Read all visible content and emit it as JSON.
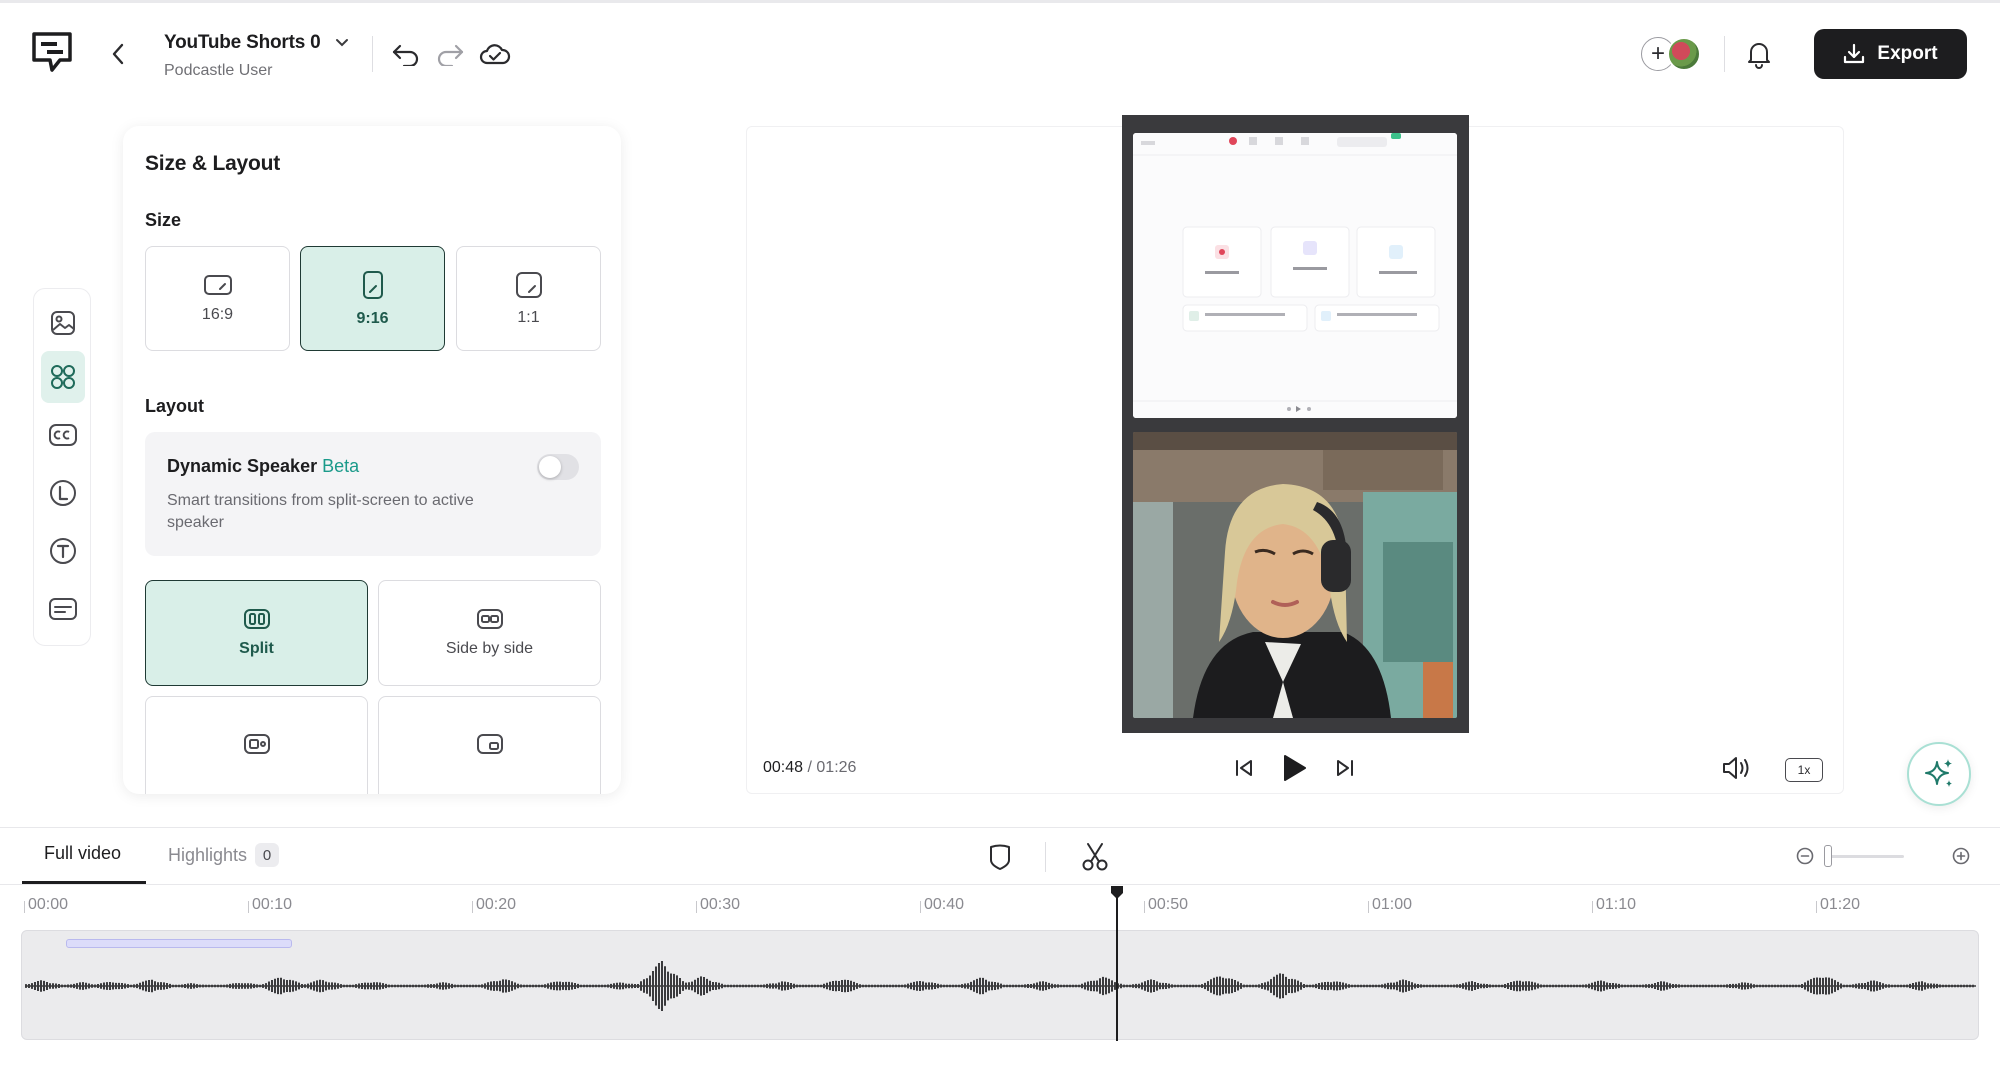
{
  "header": {
    "project_title": "YouTube Shorts 0",
    "project_subtitle": "Podcastle User",
    "export_label": "Export"
  },
  "sidebar_tools": [
    {
      "icon": "image-icon",
      "active": false
    },
    {
      "icon": "layout-grid-icon",
      "active": true
    },
    {
      "icon": "captions-icon",
      "active": false
    },
    {
      "icon": "logo-l-icon",
      "active": false
    },
    {
      "icon": "text-t-icon",
      "active": false
    },
    {
      "icon": "subtitles-icon",
      "active": false
    }
  ],
  "panel": {
    "title": "Size & Layout",
    "size_label": "Size",
    "sizes": [
      {
        "label": "16:9",
        "selected": false
      },
      {
        "label": "9:16",
        "selected": true
      },
      {
        "label": "1:1",
        "selected": false
      }
    ],
    "layout_label": "Layout",
    "dynamic_speaker": {
      "title": "Dynamic Speaker",
      "beta": "Beta",
      "description": "Smart transitions from split-screen to active speaker",
      "enabled": false
    },
    "layouts": [
      {
        "label": "Split",
        "selected": true
      },
      {
        "label": "Side by side",
        "selected": false
      },
      {
        "label": "",
        "selected": false
      },
      {
        "label": "",
        "selected": false
      }
    ]
  },
  "player": {
    "current_time": "00:48",
    "separator": " / ",
    "duration": "01:26",
    "speed": "1x"
  },
  "timeline": {
    "tabs": [
      {
        "label": "Full video",
        "active": true
      },
      {
        "label": "Highlights",
        "active": false,
        "count": "0"
      }
    ],
    "ticks": [
      "00:00",
      "00:10",
      "00:20",
      "00:30",
      "00:40",
      "00:50",
      "01:00",
      "01:10",
      "01:20"
    ],
    "playhead_seconds": 48,
    "total_seconds": 86
  },
  "colors": {
    "accent": "#1a9a8a",
    "selected_bg": "#d9efe8",
    "export_bg": "#1d1d1f"
  }
}
